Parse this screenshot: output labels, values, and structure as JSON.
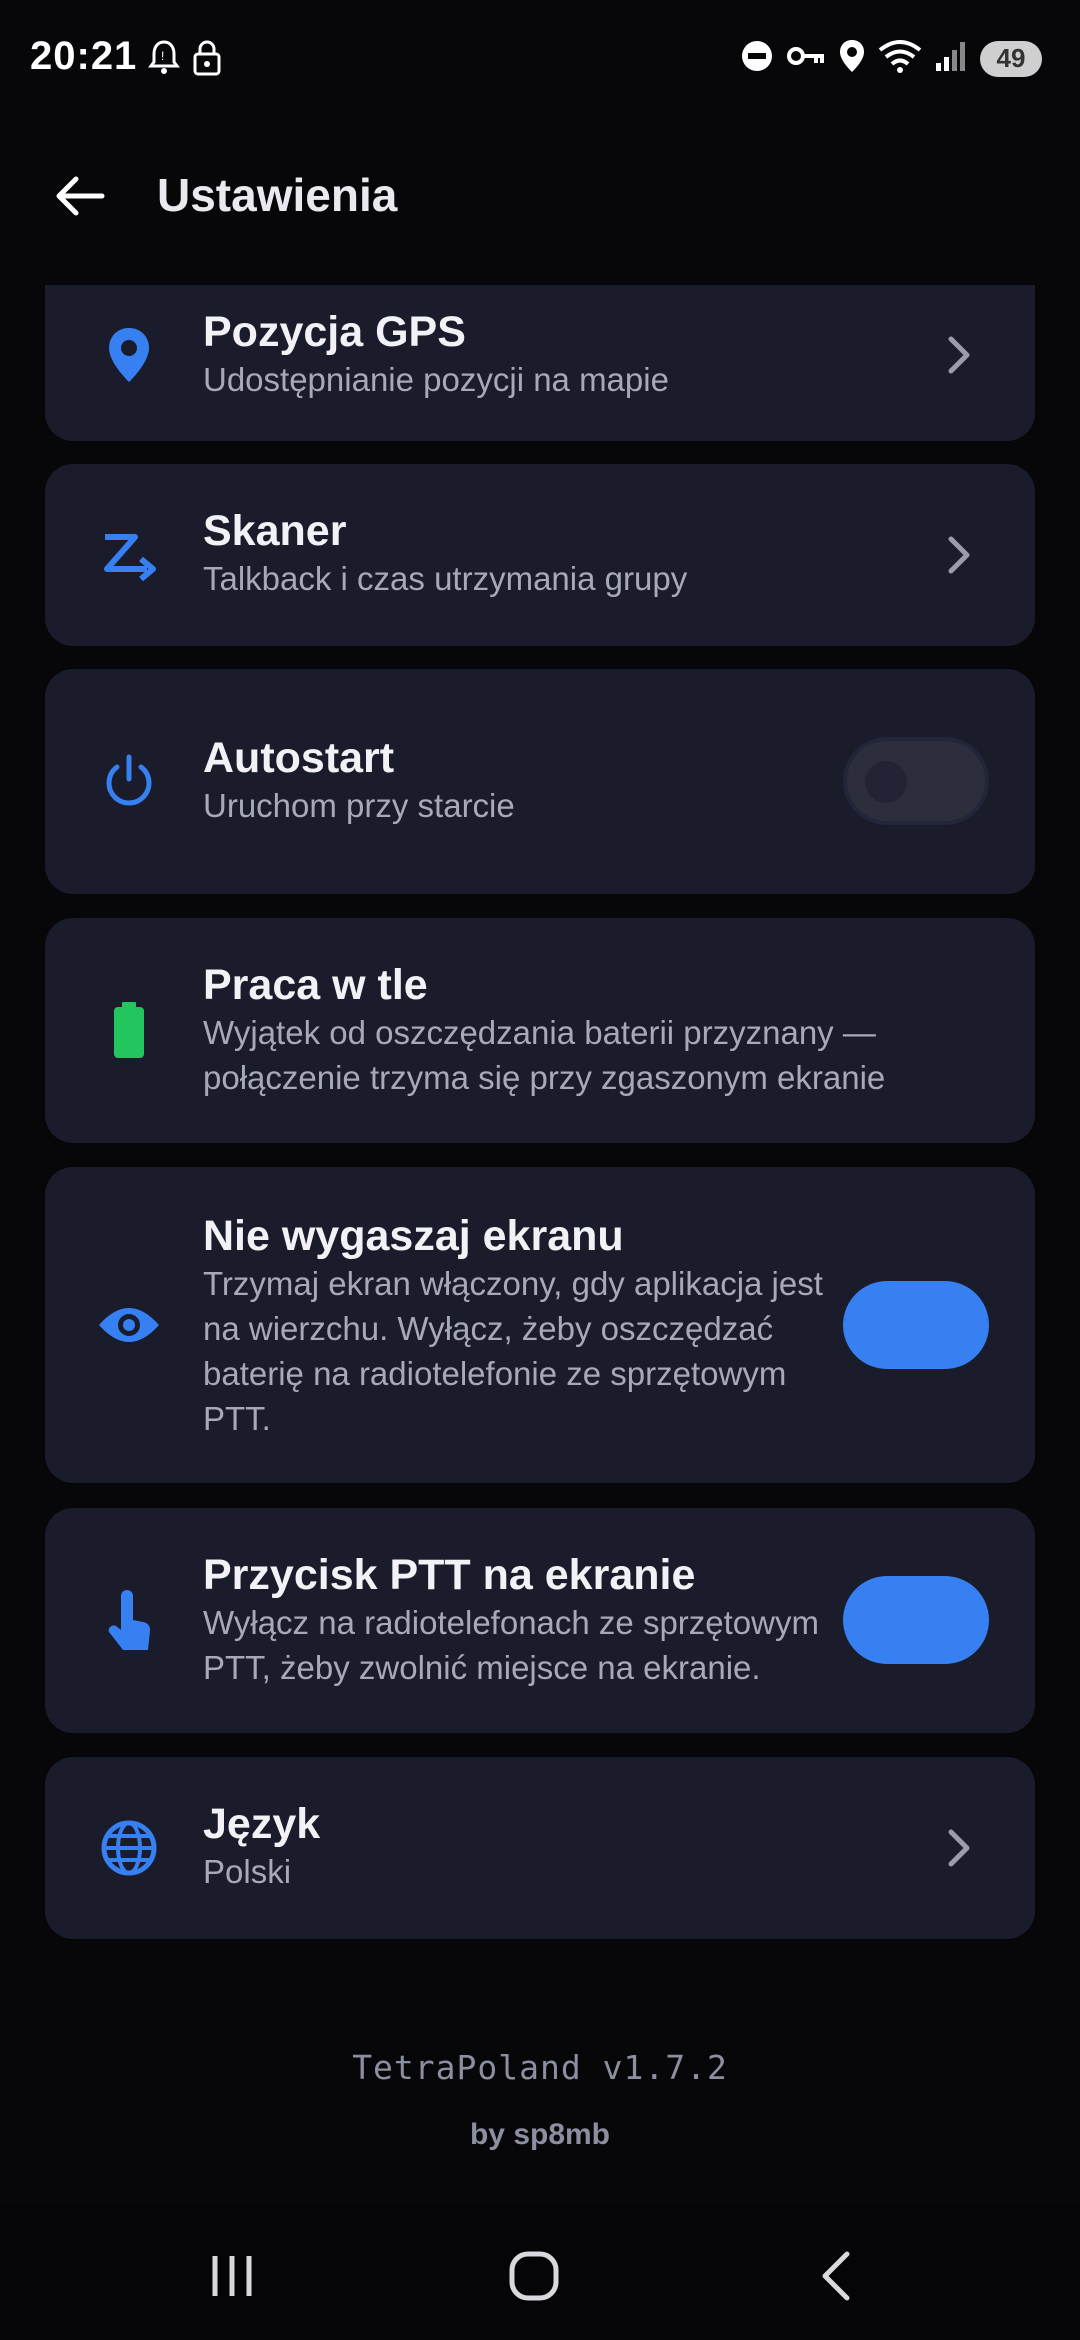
{
  "status_bar": {
    "time": "20:21",
    "battery": "49",
    "icons": [
      "notification-icon",
      "lock-icon",
      "dnd-icon",
      "vpn-key-icon",
      "location-icon",
      "wifi-icon",
      "signal-icon"
    ]
  },
  "app_bar": {
    "title": "Ustawienia",
    "back_icon": "arrow-left-icon"
  },
  "colors": {
    "accent": "#3680f2",
    "card_bg": "#1a1b2b",
    "battery_green": "#22c55e"
  },
  "settings": [
    {
      "title": "Pozycja GPS",
      "subtitle": "Udostępnianie pozycji na mapie",
      "icon": "location-pin-icon",
      "control": "chevron"
    },
    {
      "title": "Skaner",
      "subtitle": "Talkback i czas utrzymania grupy",
      "icon": "scanner-icon",
      "control": "chevron"
    },
    {
      "title": "Autostart",
      "subtitle": "Uruchom przy starcie",
      "icon": "power-icon",
      "control": "toggle",
      "enabled": false
    },
    {
      "title": "Praca w tle",
      "subtitle_lines": [
        "Wyjątek od oszczędzania baterii przyznany —",
        "połączenie trzyma się przy zgaszonym ekranie"
      ],
      "icon": "battery-icon",
      "control": "none"
    },
    {
      "title": "Nie wygaszaj ekranu",
      "subtitle_lines": [
        "Trzymaj ekran włączony, gdy aplikacja jest",
        "na wierzchu. Wyłącz, żeby oszczędzać",
        "baterię na radiotelefonie ze sprzętowym",
        "PTT."
      ],
      "icon": "eye-icon",
      "control": "toggle",
      "enabled": true
    },
    {
      "title": "Przycisk PTT na ekranie",
      "subtitle_lines": [
        "Wyłącz na radiotelefonach ze sprzętowym",
        "PTT, żeby zwolnić miejsce na ekranie."
      ],
      "icon": "touch-icon",
      "control": "toggle",
      "enabled": true
    },
    {
      "title": "Język",
      "subtitle": "Polski",
      "icon": "globe-icon",
      "control": "chevron"
    }
  ],
  "footer": {
    "version": "TetraPoland v1.7.2",
    "author": "by sp8mb"
  },
  "nav_bar": {
    "buttons": [
      "recent-apps-icon",
      "home-icon",
      "back-icon"
    ]
  }
}
